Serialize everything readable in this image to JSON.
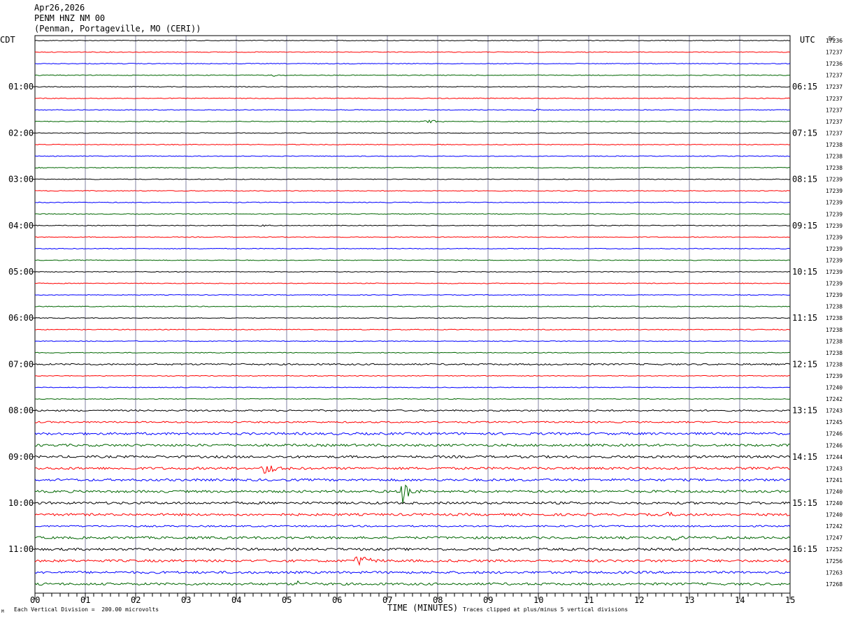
{
  "header": {
    "date": "Apr26,2026",
    "station": "PENM HNZ NM 00",
    "location": "(Penman, Portageville, MO (CERI))"
  },
  "left_axis_label": "CDT",
  "right_axis_label": "UTC",
  "dc_label": "DC",
  "footer": {
    "scale_note": "Each Vertical Division =  200.00 microvolts",
    "clip_note": "Traces clipped at plus/minus 5 vertical divisions",
    "corner_mark": "M"
  },
  "colors": {
    "cycle": [
      "#000000",
      "#ff0000",
      "#0000ff",
      "#006600"
    ],
    "grid": "#8080a0"
  },
  "chart_data": {
    "type": "line",
    "title": "",
    "xlabel": "TIME (MINUTES)",
    "ylabel": "",
    "xlim": [
      0,
      15
    ],
    "x_ticks": [
      "00",
      "01",
      "02",
      "03",
      "04",
      "05",
      "06",
      "07",
      "08",
      "09",
      "10",
      "11",
      "12",
      "13",
      "14",
      "15"
    ],
    "left_time_labels": [
      "01:00",
      "02:00",
      "03:00",
      "04:00",
      "05:00",
      "06:00",
      "07:00",
      "08:00",
      "09:00",
      "10:00",
      "11:00"
    ],
    "right_time_labels": [
      "06:15",
      "07:15",
      "08:15",
      "09:15",
      "10:15",
      "11:15",
      "12:15",
      "13:15",
      "14:15",
      "15:15",
      "16:15"
    ],
    "dc_offsets": [
      17236,
      17237,
      17236,
      17237,
      17237,
      17237,
      17237,
      17237,
      17237,
      17238,
      17238,
      17238,
      17239,
      17239,
      17239,
      17239,
      17239,
      17239,
      17239,
      17239,
      17239,
      17239,
      17239,
      17238,
      17238,
      17238,
      17238,
      17238,
      17238,
      17239,
      17240,
      17242,
      17243,
      17245,
      17246,
      17246,
      17244,
      17243,
      17241,
      17240,
      17240,
      17240,
      17242,
      17247,
      17252,
      17256,
      17263,
      17268
    ],
    "activity": [
      1,
      1,
      1,
      1,
      1,
      1,
      1,
      1,
      1,
      1,
      1,
      1,
      1,
      1,
      1,
      1,
      1,
      1,
      1,
      1,
      1,
      1,
      1,
      1,
      1,
      1,
      1,
      1,
      2,
      1,
      1,
      1,
      2,
      2,
      3,
      3,
      3,
      3,
      3,
      3,
      3,
      3,
      2,
      3,
      3,
      3,
      3,
      3
    ],
    "events": [
      {
        "trace": 3,
        "minute": 4.7,
        "amplitude": 2
      },
      {
        "trace": 6,
        "minute": 9.9,
        "amplitude": 3
      },
      {
        "trace": 7,
        "minute": 7.8,
        "amplitude": 4
      },
      {
        "trace": 16,
        "minute": 4.5,
        "amplitude": 2
      },
      {
        "trace": 37,
        "minute": 4.55,
        "amplitude": 14
      },
      {
        "trace": 39,
        "minute": 7.3,
        "amplitude": 18
      },
      {
        "trace": 41,
        "minute": 12.5,
        "amplitude": 5
      },
      {
        "trace": 43,
        "minute": 12.65,
        "amplitude": 6
      },
      {
        "trace": 45,
        "minute": 6.4,
        "amplitude": 13
      },
      {
        "trace": 47,
        "minute": 5.2,
        "amplitude": 5
      }
    ]
  }
}
